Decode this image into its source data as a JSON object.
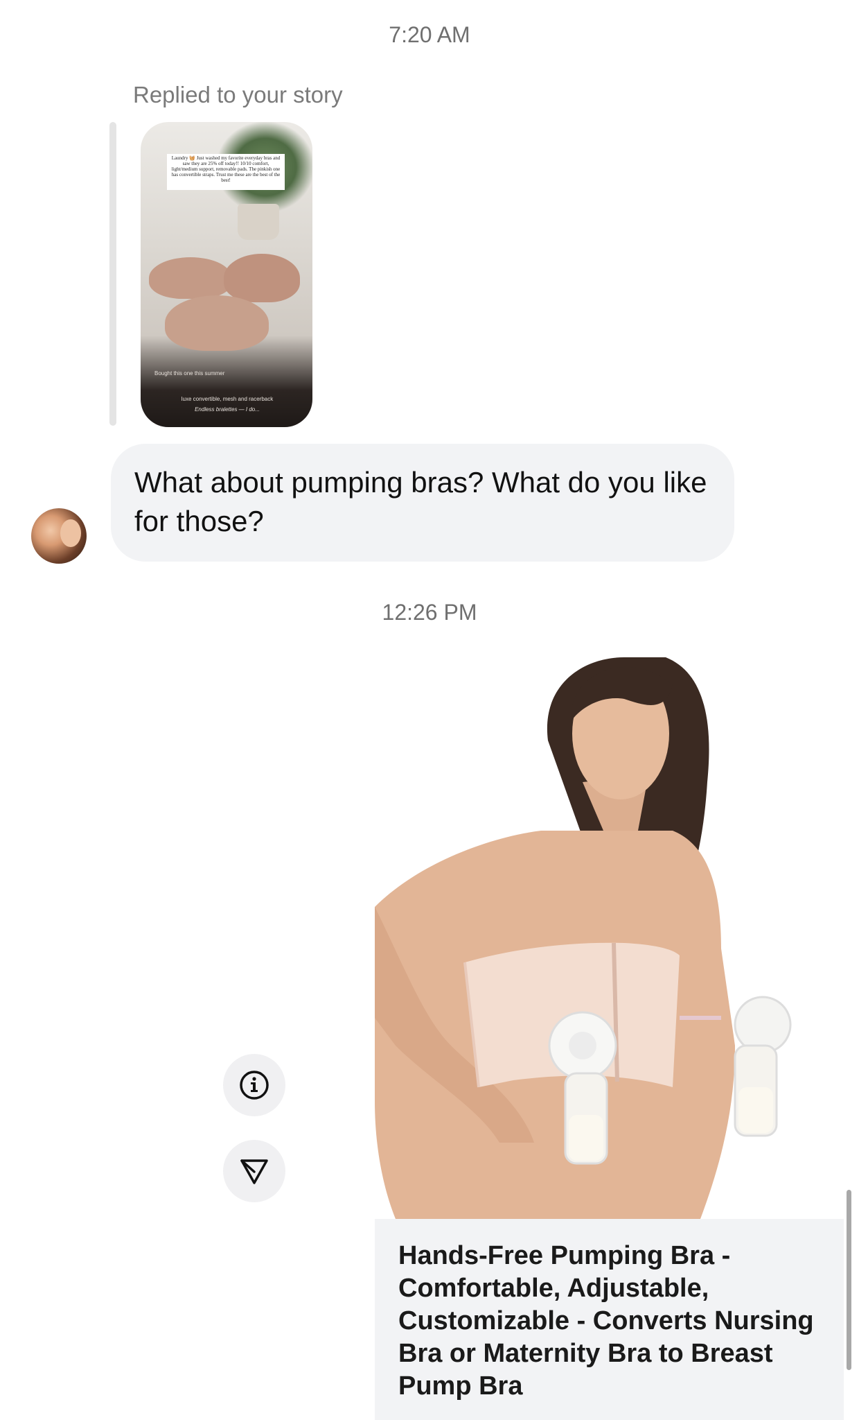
{
  "messages": {
    "timestamp_1": "7:20 AM",
    "reply_label": "Replied to your story",
    "story": {
      "note_text": "Laundry 🧺 Just washed my favorite everyday bras and saw they are 25% off today!! 10/10 comfort, light/medium support, removable pads. The pinkish one has convertible straps. Trust me these are the best of the best!",
      "caption_1": "Bought this one this summer",
      "caption_2": "luxe convertible, mesh and racerback",
      "caption_3": "Endless bralettes — I do..."
    },
    "incoming_text": "What about pumping bras? What do you like for those?",
    "timestamp_2": "12:26 PM"
  },
  "product": {
    "title": "Hands-Free Pumping Bra - Comfortable, Adjustable, Customizable - Converts Nursing Bra or Maternity Bra to Breast Pump Bra"
  },
  "actions": {
    "info_icon": "info-icon",
    "share_icon": "paper-plane-icon"
  },
  "colors": {
    "bubble_bg": "#f2f3f5",
    "timestamp": "#6f6f6f",
    "text": "#111111"
  }
}
